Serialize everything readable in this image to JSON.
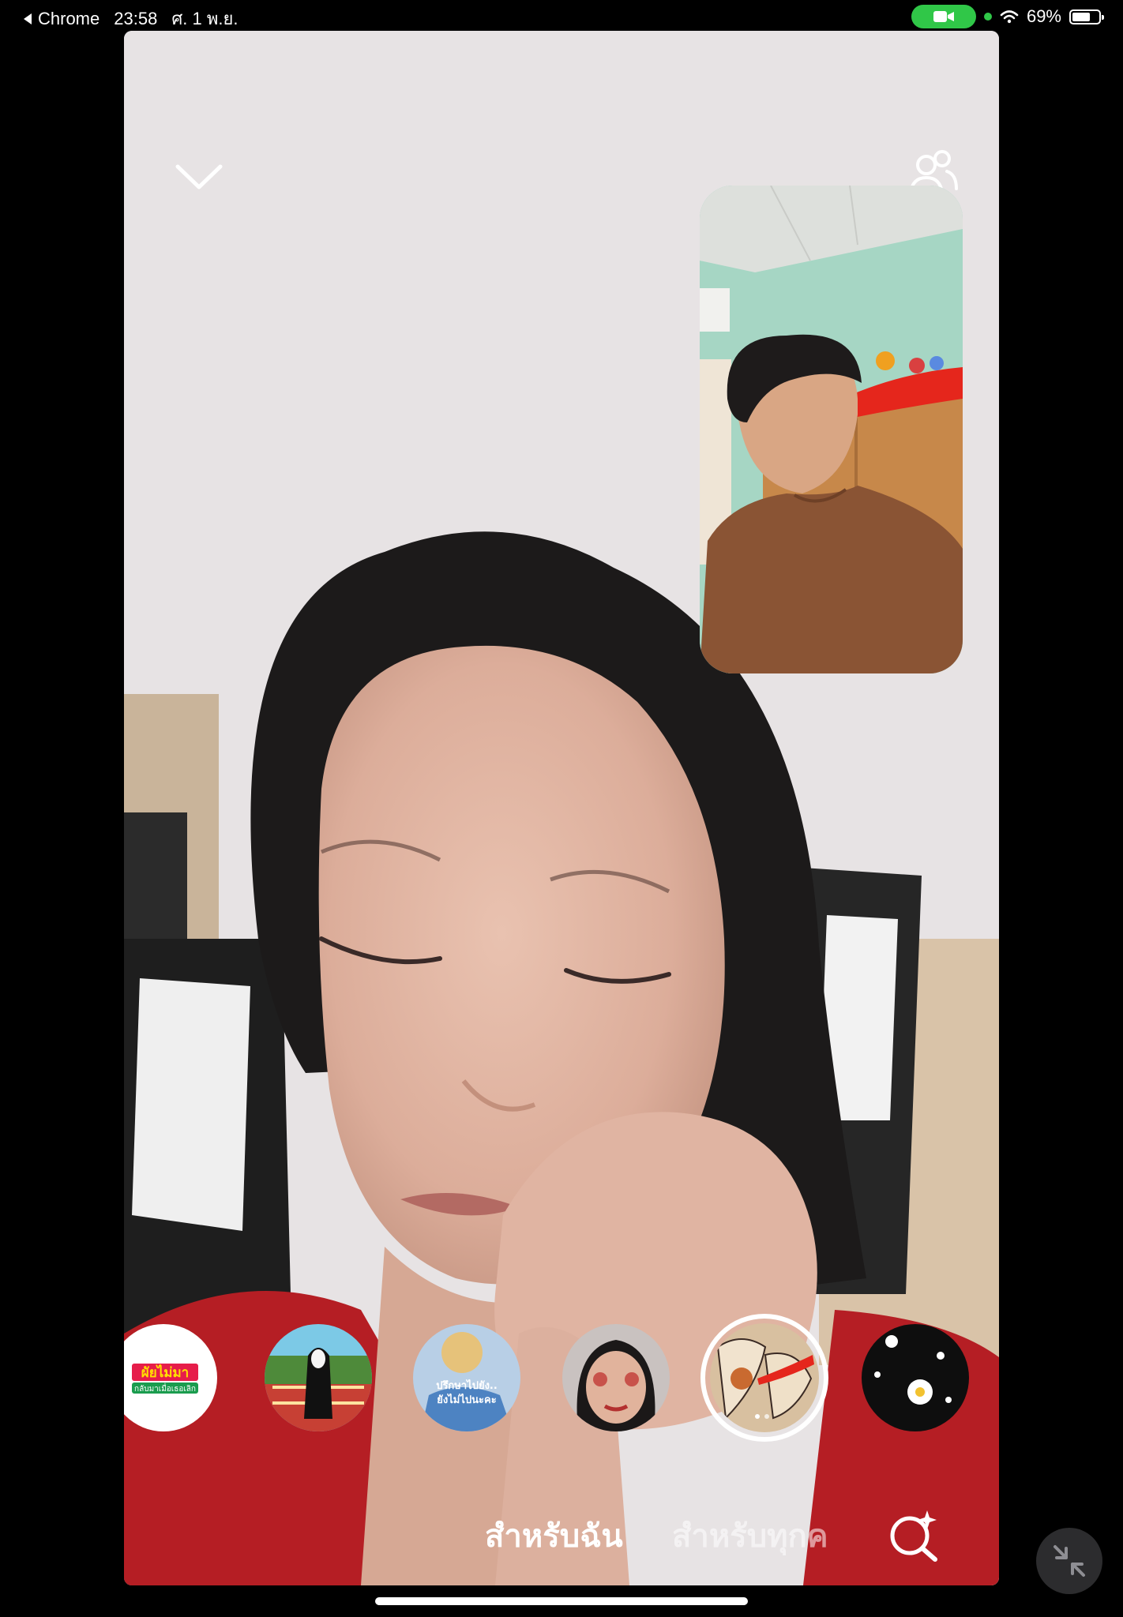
{
  "status_bar": {
    "back_app": "Chrome",
    "time": "23:58",
    "date": "ศ. 1 พ.ย.",
    "battery_percent": "69%",
    "battery_level": 0.69
  },
  "call": {
    "controls": {
      "collapse": "chevron-down-icon",
      "participants": "participants-icon",
      "search_effects": "search-sparkle-icon",
      "minimize": "minimize-arrows-icon"
    }
  },
  "effects": {
    "items": [
      {
        "name": "effect-sticker-text",
        "text_lines": [
          "ผัยไม่มา",
          "กลับมาเมื่อเธอเลิก"
        ]
      },
      {
        "name": "effect-no-face"
      },
      {
        "name": "effect-text-meme",
        "text_lines": [
          "ปรึกษาไปยัง..",
          "ยังไม่ไปนะคะ"
        ]
      },
      {
        "name": "effect-face-makeup"
      },
      {
        "name": "effect-anime-red-eye",
        "selected": true
      },
      {
        "name": "effect-daisy-flowers"
      }
    ]
  },
  "tabs": {
    "active": "สำหรับฉัน",
    "inactive": "สำหรับทุกค"
  },
  "colors": {
    "status_green": "#30c748",
    "selection_ring": "#ffffff"
  }
}
